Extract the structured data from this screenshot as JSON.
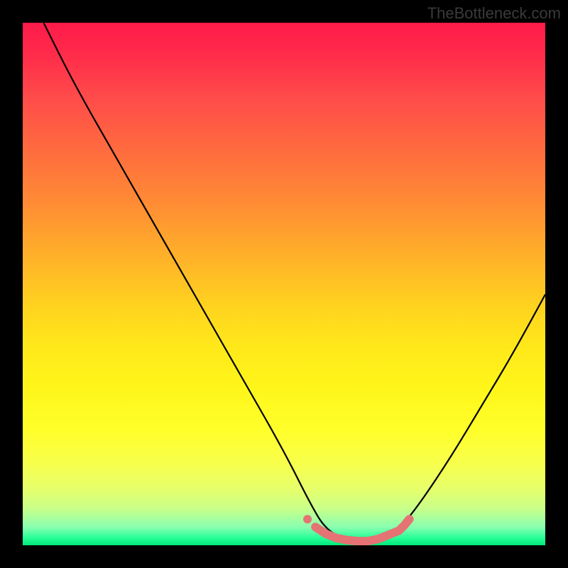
{
  "watermark": "TheBottleneck.com",
  "chart_data": {
    "type": "line",
    "title": "",
    "xlabel": "",
    "ylabel": "",
    "xlim": [
      0,
      100
    ],
    "ylim": [
      0,
      100
    ],
    "grid": false,
    "series": [
      {
        "name": "bottleneck-curve",
        "x": [
          4,
          10,
          18,
          26,
          34,
          42,
          50,
          55,
          58,
          62,
          66,
          70,
          72,
          76,
          82,
          88,
          94,
          100
        ],
        "y": [
          100,
          88,
          74,
          60,
          46,
          32,
          18,
          8,
          3,
          1,
          0.5,
          1,
          3,
          8,
          17,
          27,
          37,
          48
        ]
      }
    ],
    "markers": [
      {
        "name": "highlight-region",
        "x": [
          56,
          58,
          60,
          62,
          64,
          66,
          68,
          70,
          72,
          73,
          74
        ],
        "y": [
          3.5,
          2.2,
          1.4,
          1.0,
          0.8,
          0.8,
          1.2,
          2.0,
          2.8,
          3.8,
          5.0
        ]
      }
    ],
    "gradient_stops": [
      {
        "pos": 0.0,
        "color": "#ff1a4a"
      },
      {
        "pos": 0.24,
        "color": "#ff6a3f"
      },
      {
        "pos": 0.54,
        "color": "#ffd21f"
      },
      {
        "pos": 0.78,
        "color": "#ffff2a"
      },
      {
        "pos": 0.93,
        "color": "#c8ff8a"
      },
      {
        "pos": 1.0,
        "color": "#00e878"
      }
    ]
  }
}
